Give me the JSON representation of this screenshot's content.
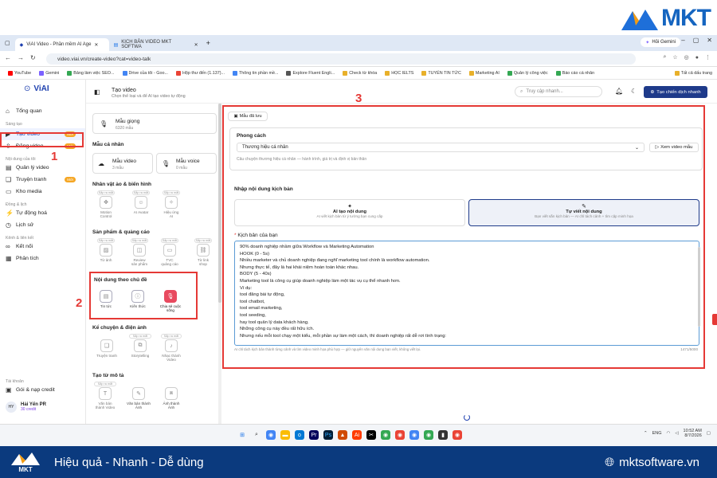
{
  "brand": {
    "logo_text": "MKT"
  },
  "browser": {
    "tabs": [
      {
        "label": "ViAI Video - Phần mềm AI Age"
      },
      {
        "label": "KỊCH BẢN VIDEO MKT SOFTWA"
      }
    ],
    "gemini": "Hỏi Gemini",
    "url": "video.viai.vn/create-video?cat=video-talk",
    "bookmarks": [
      "YouTube",
      "Gemini",
      "Bảng làm việc SEO...",
      "Drive của tôi - Goo...",
      "Hộp thư đến (1.137)...",
      "Thông tin phần mề...",
      "Explore Fluent Engli...",
      "Check từ khóa",
      "HỌC IELTS",
      "TUYỂN TIN TỨC",
      "Marketing AI",
      "Quản lý công việc",
      "Báo cáo cá nhân"
    ],
    "all_bookmarks": "Tất cả dấu trang"
  },
  "sidebar": {
    "logo": "ViAI",
    "items": [
      {
        "label": "Tổng quan"
      },
      {
        "section": "Sáng tạo"
      },
      {
        "label": "Tạo video",
        "badge": "Mới"
      },
      {
        "label": "Đăng video",
        "badge": "Mới"
      },
      {
        "section": "Nội dung của tôi"
      },
      {
        "label": "Quản lý video"
      },
      {
        "label": "Truyện tranh",
        "badge": "Mới"
      },
      {
        "label": "Kho media"
      },
      {
        "section": "Đồng & lịch"
      },
      {
        "label": "Tự động hoá"
      },
      {
        "label": "Lịch sử"
      },
      {
        "section": "Kênh & liên kết"
      },
      {
        "label": "Kết nối"
      },
      {
        "label": "Phân tích"
      }
    ],
    "account_section": "Tài khoản",
    "credit_link": "Gói & nạp credit",
    "user": {
      "initials": "HY",
      "name": "Hải Yến PR",
      "credit": "30 credit"
    }
  },
  "header": {
    "title": "Tạo video",
    "subtitle": "Chọn thể loại và để AI tạo video tự động",
    "search_placeholder": "Truy cập nhanh...",
    "cta": "Tạo chiến dịch nhanh"
  },
  "mid": {
    "voice_card": {
      "title": "Mẫu giọng",
      "count": "6320 mẫu"
    },
    "personal": {
      "title": "Mẫu cá nhân",
      "cards": [
        {
          "title": "Mẫu video",
          "count": "3 mẫu"
        },
        {
          "title": "Mẫu voice",
          "count": "0 mẫu"
        }
      ]
    },
    "groups": [
      {
        "title": "Nhân vật ảo & biến hình",
        "tiles": [
          {
            "label": "Motion Control",
            "soon": "Sắp ra mắt"
          },
          {
            "label": "AI Avatar",
            "soon": "Sắp ra mắt"
          },
          {
            "label": "Hiệu ứng AI",
            "soon": "Sắp ra mắt"
          }
        ]
      },
      {
        "title": "Sản phẩm & quảng cáo",
        "tiles": [
          {
            "label": "Từ ảnh",
            "soon": "Sắp ra mắt"
          },
          {
            "label": "Review sản phẩm",
            "soon": "Sắp ra mắt"
          },
          {
            "label": "TVC quảng cáo",
            "soon": "Sắp ra mắt"
          },
          {
            "label": "Từ link shop",
            "soon": "Sắp ra mắt"
          }
        ]
      },
      {
        "title": "Nội dung theo chủ đề",
        "tiles": [
          {
            "label": "Tin tức"
          },
          {
            "label": "Kiến thức"
          },
          {
            "label": "Chia sẻ cuộc sống"
          }
        ]
      },
      {
        "title": "Kể chuyện & điện ảnh",
        "tiles": [
          {
            "label": "Truyện tranh"
          },
          {
            "label": "Storytelling",
            "soon": "Sắp ra mắt"
          },
          {
            "label": "Nhạc thành Video",
            "soon": "Sắp ra mắt"
          }
        ]
      },
      {
        "title": "Tạo từ mô tả",
        "tiles": [
          {
            "label": "Văn bản thành Video",
            "soon": "Sắp ra mắt"
          },
          {
            "label": "Văn bản thành Ảnh"
          },
          {
            "label": "Ảnh thành Ảnh"
          }
        ]
      }
    ]
  },
  "form": {
    "saved_btn": "Mẫu đã lưu",
    "style_label": "Phong cách",
    "style_value": "Thương hiệu cá nhân",
    "style_desc": "Câu chuyện thương hiệu cá nhân — hành trình, giá trị và định vị bản thân",
    "sample_btn": "Xem video mẫu",
    "input_label": "Nhập nội dung kịch bản",
    "ai_option": {
      "title": "AI tạo nội dung",
      "desc": "AI viết kịch bản từ ý tưởng bạn cung cấp"
    },
    "manual_option": {
      "title": "Tự viết nội dung",
      "desc": "Bạn viết sẵn kịch bản — AI chỉ tách cảnh + tìm cặp minh họa"
    },
    "script_label": "Kịch bản của bạn",
    "script_lines": [
      "90% doanh nghiệp nhầm giữa Workflow và Marketing Automation",
      "HOOK (0 - 5s)",
      "Nhiều marketer và chủ doanh nghiệp đang nghĩ marketing tool chính là workflow automation.",
      "Nhưng thực tế, đây là hai khái niệm hoàn toàn khác nhau.",
      "BODY (5 - 40s)",
      "Marketing tool là công cụ giúp doanh nghiệp làm một tác vụ cụ thể nhanh hơn.",
      "Ví dụ:",
      "tool đăng bài tự động,",
      "tool chatbot,",
      "tool email marketing,",
      "tool seeding,",
      "hay tool quản lý data khách hàng.",
      "Những công cụ này đều rất hữu ích.",
      "Nhưng nếu mỗi tool chạy một kiểu, mỗi phần sự làm một cách, thì doanh nghiệp rất dễ rơi tình trạng:"
    ],
    "hint": "AI chỉ tách kịch bản thành từng cảnh và tìm video minh họa phù hợp — giữ nguyên văn nội dung bạn viết, không viết lại.",
    "counter": "1471/5000"
  },
  "annotations": {
    "n1": "1",
    "n2": "2",
    "n3": "3"
  },
  "taskbar": {
    "time": "10:52 AM",
    "date": "8/7/2026",
    "lang": "ENG"
  },
  "footer": {
    "slogan": "Hiệu quả - Nhanh - Dễ dùng",
    "site": "mktsoftware.vn",
    "logo": "MKT"
  },
  "colors": {
    "accent": "#1e40af",
    "annotation": "#e53935",
    "footer": "#0b3a7e",
    "badge": "#f5a623"
  }
}
